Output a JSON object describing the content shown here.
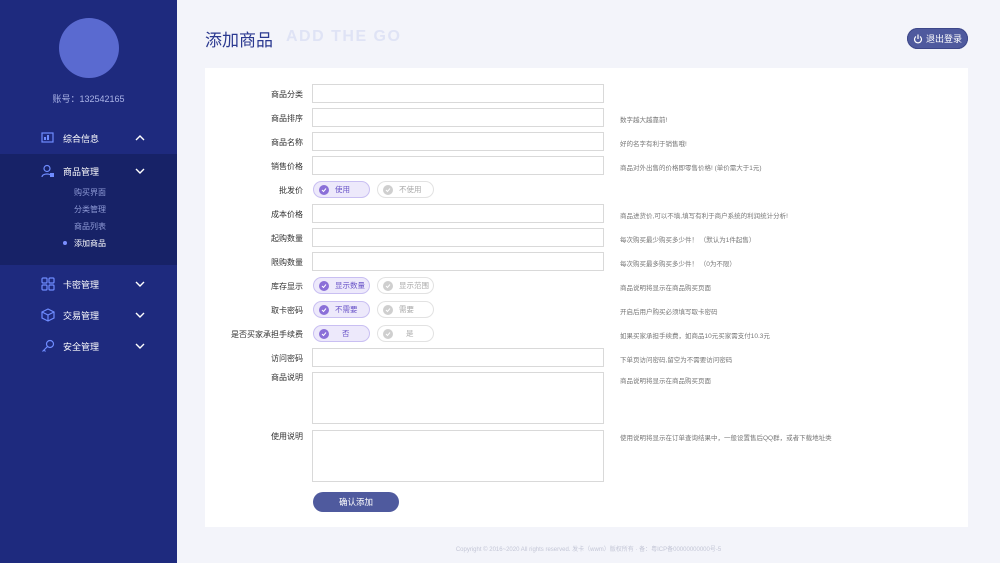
{
  "sidebar": {
    "account_label": "账号：132542165",
    "menu": [
      {
        "label": "综合信息",
        "icon": "dashboard-icon",
        "chevron": "up"
      },
      {
        "label": "商品管理",
        "icon": "user-goods-icon",
        "chevron": "down"
      },
      {
        "label": "卡密管理",
        "icon": "grid-icon",
        "chevron": "down"
      },
      {
        "label": "交易管理",
        "icon": "box-icon",
        "chevron": "down"
      },
      {
        "label": "安全管理",
        "icon": "key-icon",
        "chevron": "down"
      }
    ],
    "submenu": [
      "购买界面",
      "分类管理",
      "商品列表",
      "添加商品"
    ]
  },
  "header": {
    "title": "添加商品",
    "ghost_title": "ADD THE GO",
    "logout_label": "退出登录"
  },
  "form": {
    "fields": [
      {
        "label": "商品分类",
        "hint": ""
      },
      {
        "label": "商品排序",
        "hint": "数字越大越靠前!"
      },
      {
        "label": "商品名称",
        "hint": "好的名字有利于销售哦!"
      },
      {
        "label": "销售价格",
        "hint": "商品对外出售的价格即零售价格! (单价需大于1元)"
      },
      {
        "label": "批发价",
        "hint": ""
      },
      {
        "label": "成本价格",
        "hint": "商品进货价,可以不填,填写有利于商户系统的利润统计分析!"
      },
      {
        "label": "起购数量",
        "hint": "每次购买最少购买多少件！ （默认为1件起售）"
      },
      {
        "label": "限购数量",
        "hint": "每次购买最多购买多少件！ （0为不限）"
      },
      {
        "label": "库存显示",
        "hint": "商品说明将显示在商品购买页面"
      },
      {
        "label": "取卡密码",
        "hint": "开启后用户购买必须填写取卡密码"
      },
      {
        "label": "是否买家承担手续费",
        "hint": "如果买家承担手续费，如商品10元买家需支付10.3元"
      },
      {
        "label": "访问密码",
        "hint": "下单页访问密码,留空为不需要访问密码"
      },
      {
        "label": "商品说明",
        "hint": "商品说明将显示在商品购买页面"
      },
      {
        "label": "使用说明",
        "hint": "使用说明将显示在订单查询结果中，一般设置售后QQ群，或者下载地址类"
      }
    ],
    "toggles": {
      "wholesale": [
        "使用",
        "不使用"
      ],
      "stock": [
        "显示数量",
        "显示范围"
      ],
      "card_password": [
        "不需要",
        "需要"
      ],
      "buyer_fee": [
        "否",
        "是"
      ]
    },
    "submit_label": "确认添加"
  },
  "footer": "Copyright © 2016~2020 All rights reserved. 发卡（wwm）版权所有 · 备：粤ICP备00000000000号-5",
  "colors": {
    "sidebar": "#1e2a7e",
    "accent": "#4f5a9e",
    "toggle_on": "#8a6fd8"
  }
}
